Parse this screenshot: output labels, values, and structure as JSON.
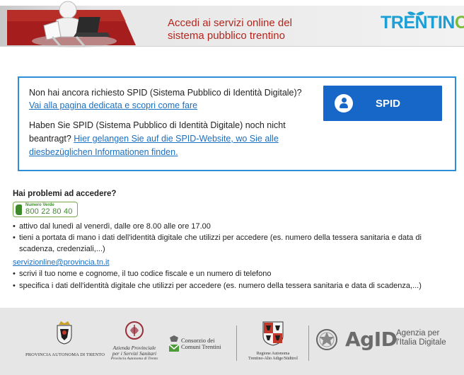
{
  "header": {
    "title_line1": "Accedi ai servizi online del",
    "title_line2": "sistema pubblico trentino",
    "brand_logo": "TRENTINO"
  },
  "spid": {
    "it_question": "Non hai ancora richiesto SPID (Sistema Pubblico di Identità Digitale)?",
    "it_link": "Vai alla pagina dedicata e scopri come fare",
    "de_question": "Haben Sie SPID (Sistema Pubblico di Identità Digitale) noch nicht beantragt?",
    "de_link": "Hier gelangen Sie auf die SPID-Website, wo Sie alle diesbezüglichen Informationen finden.",
    "button_label": "SPID",
    "button_icon": "user-icon"
  },
  "help": {
    "title": "Hai problemi ad accedere?",
    "phone_label": "Numero Verde",
    "phone_number": "800 22 80 40",
    "phone_items": [
      "attivo dal lunedì al venerdì, dalle ore 8.00 alle ore 17.00",
      "tieni a portata di mano i dati dell'identità digitale che utilizzi per accedere (es. numero della tessera sanitaria e data di scadenza, credenziali,...)"
    ],
    "email": "servizionline@provincia.tn.it",
    "email_items": [
      "scrivi il tuo nome e cognome, il tuo codice fiscale e un numero di telefono",
      "specifica i dati dell'identità digitale che utilizzi per accedere (es. numero della tessera sanitaria e data di scadenza,...)"
    ]
  },
  "footer": {
    "pat": "PROVINCIA AUTONOMA DI TRENTO",
    "asl_line1": "Azienda Provinciale",
    "asl_line2": "per i Servizi Sanitari",
    "asl_line3": "Provincia Autonoma di Trento",
    "consorzio_line1": "Consorzio dei",
    "consorzio_line2": "Comuni Trentini",
    "regione_line1": "Regione Autonoma",
    "regione_line2": "Trentino-Alto Adige/Südtirol",
    "agid": "AgID",
    "agid_sub_line1": "Agenzia per",
    "agid_sub_line2": "l'Italia Digitale"
  },
  "colors": {
    "header_title": "#b3261e",
    "spid_border": "#2d8dd6",
    "spid_button": "#1667c7",
    "link": "#1b6fc0",
    "phone_green": "#3e8a2b",
    "footer_bg": "#e6e6e6"
  }
}
